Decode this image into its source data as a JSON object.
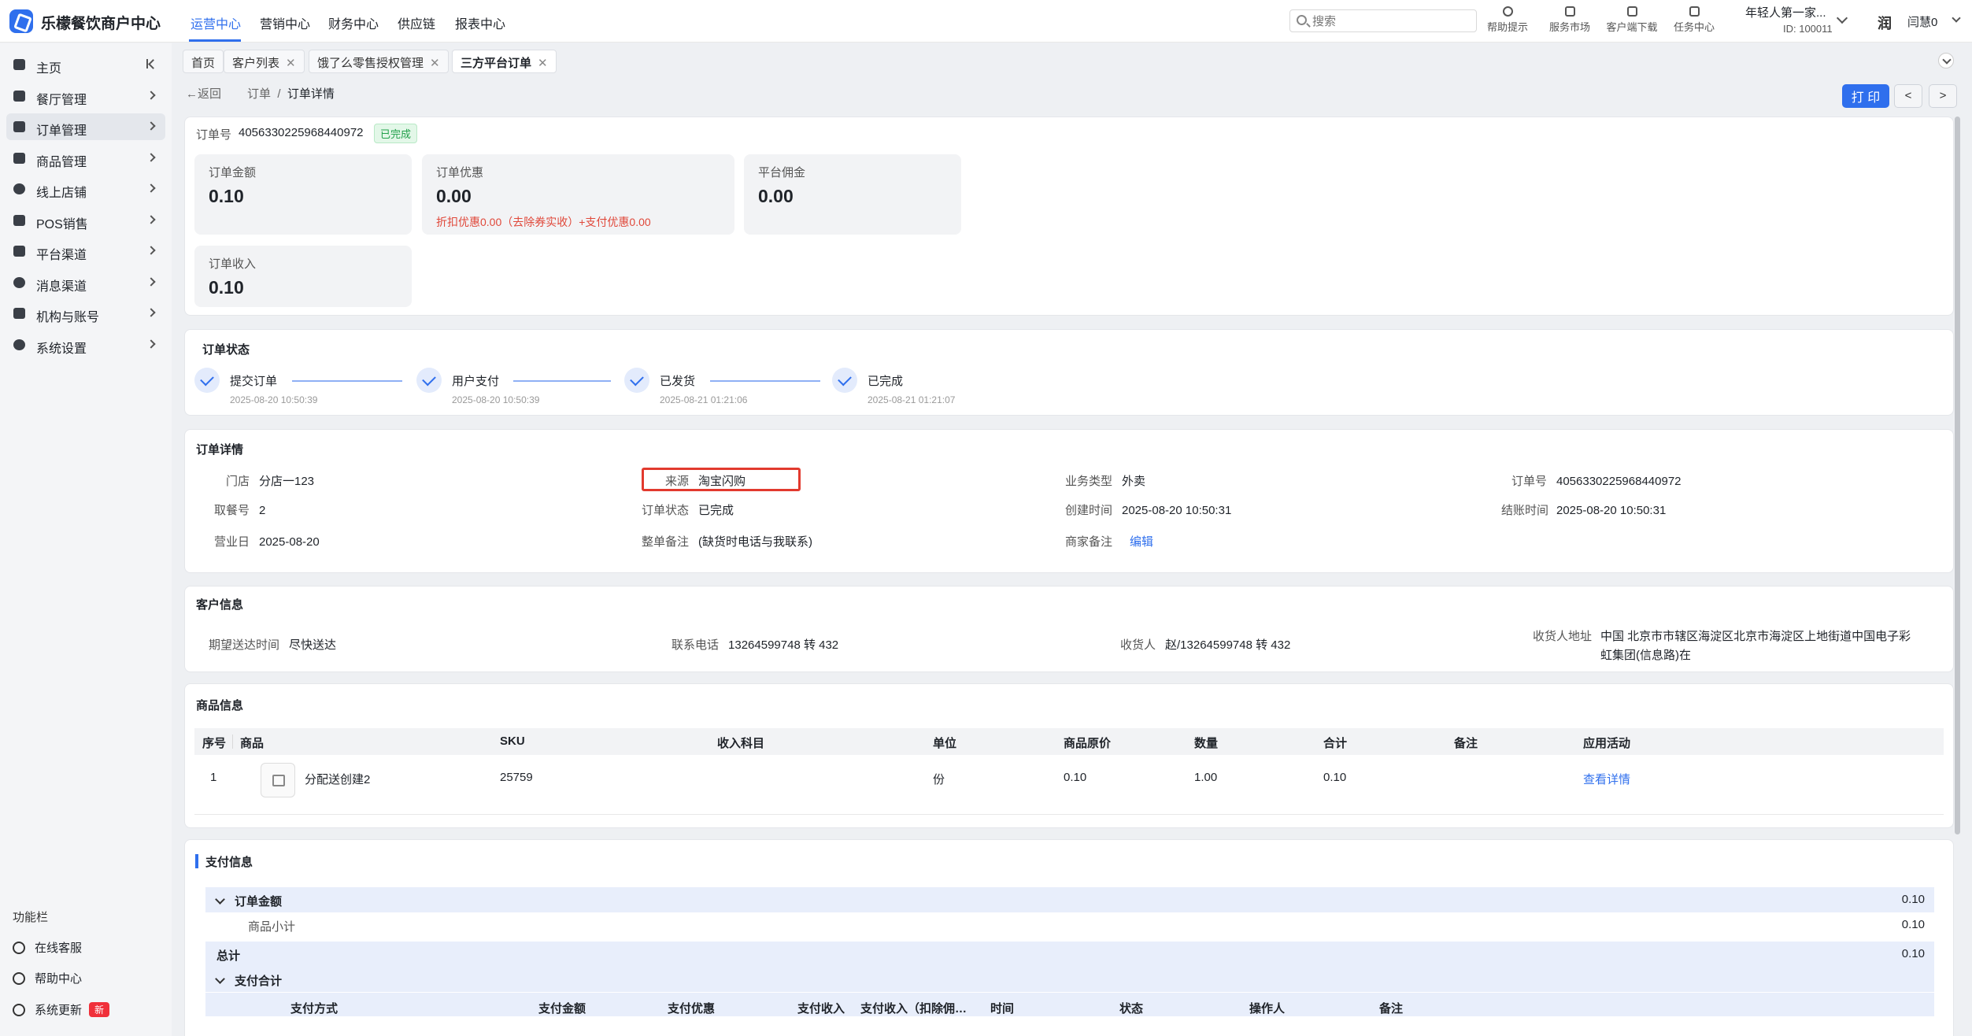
{
  "app": {
    "brand": "乐檬餐饮商户中心",
    "nav": [
      "运营中心",
      "营销中心",
      "财务中心",
      "供应链",
      "报表中心"
    ],
    "search_placeholder": "搜索",
    "tools": [
      "帮助提示",
      "服务市场",
      "客户端下载",
      "任务中心"
    ],
    "account_name": "年轻人第一家...",
    "account_id": "ID: 100011",
    "avatar_text": "润",
    "username": "闫慧0"
  },
  "sidebar": {
    "items": [
      {
        "label": "主页",
        "icon": "home-icon"
      },
      {
        "label": "餐厅管理",
        "icon": "store-icon"
      },
      {
        "label": "订单管理",
        "icon": "order-icon"
      },
      {
        "label": "商品管理",
        "icon": "goods-icon"
      },
      {
        "label": "线上店铺",
        "icon": "globe-icon"
      },
      {
        "label": "POS销售",
        "icon": "cart-icon"
      },
      {
        "label": "平台渠道",
        "icon": "bank-icon"
      },
      {
        "label": "消息渠道",
        "icon": "message-icon"
      },
      {
        "label": "机构与账号",
        "icon": "org-icon"
      },
      {
        "label": "系统设置",
        "icon": "gear-icon"
      }
    ],
    "func_title": "功能栏",
    "func_items": [
      {
        "label": "在线客服",
        "icon": "support-icon"
      },
      {
        "label": "帮助中心",
        "icon": "help-icon"
      },
      {
        "label": "系统更新",
        "icon": "refresh-icon"
      }
    ],
    "new_badge": "新"
  },
  "tabs": [
    "首页",
    "客户列表",
    "饿了么零售授权管理",
    "三方平台订单"
  ],
  "header": {
    "back": "返回",
    "crumb_parent": "订单",
    "crumb_sep": "/",
    "crumb_current": "订单详情",
    "print": "打 印",
    "prev": "<",
    "next": ">"
  },
  "order": {
    "no_label": "订单号",
    "no": "4056330225968440972",
    "status_badge": "已完成",
    "stats": [
      {
        "label": "订单金额",
        "value": "0.10",
        "note": ""
      },
      {
        "label": "订单优惠",
        "value": "0.00",
        "note": "折扣优惠0.00（去除券实收）+支付优惠0.00"
      },
      {
        "label": "平台佣金",
        "value": "0.00",
        "note": ""
      },
      {
        "label": "订单收入",
        "value": "0.10",
        "note": ""
      }
    ]
  },
  "status_section": {
    "title": "订单状态",
    "steps": [
      {
        "name": "提交订单",
        "time": "2025-08-20 10:50:39"
      },
      {
        "name": "用户支付",
        "time": "2025-08-20 10:50:39"
      },
      {
        "name": "已发货",
        "time": "2025-08-21 01:21:06"
      },
      {
        "name": "已完成",
        "time": "2025-08-21 01:21:07"
      }
    ]
  },
  "detail_section": {
    "title": "订单详情",
    "fields": {
      "store": {
        "k": "门店",
        "v": "分店一123"
      },
      "source": {
        "k": "来源",
        "v": "淘宝闪购"
      },
      "biz_type": {
        "k": "业务类型",
        "v": "外卖"
      },
      "order_no": {
        "k": "订单号",
        "v": "4056330225968440972"
      },
      "pickup": {
        "k": "取餐号",
        "v": "2"
      },
      "status": {
        "k": "订单状态",
        "v": "已完成"
      },
      "created": {
        "k": "创建时间",
        "v": "2025-08-20 10:50:31"
      },
      "settled": {
        "k": "结账时间",
        "v": "2025-08-20 10:50:31"
      },
      "biz_day": {
        "k": "营业日",
        "v": "2025-08-20"
      },
      "remark": {
        "k": "整单备注",
        "v": "(缺货时电话与我联系)"
      },
      "merchant_note": {
        "k": "商家备注",
        "v": "编辑"
      }
    }
  },
  "customer_section": {
    "title": "客户信息",
    "expected_k": "期望送达时间",
    "expected_v": "尽快送达",
    "phone_k": "联系电话",
    "phone_v": "13264599748 转 432",
    "receiver_k": "收货人",
    "receiver_v": "赵/13264599748 转 432",
    "address_k": "收货人地址",
    "address_line1": "中国 北京市市辖区海淀区北京市海淀区上地街道中国电子彩",
    "address_line2": "虹集团(信息路)在"
  },
  "goods_section": {
    "title": "商品信息",
    "columns": [
      "序号",
      "商品",
      "SKU",
      "收入科目",
      "单位",
      "商品原价",
      "数量",
      "合计",
      "备注",
      "应用活动"
    ],
    "rows": [
      {
        "idx": "1",
        "name": "分配送创建2",
        "sku": "25759",
        "subject": "",
        "unit": "份",
        "price": "0.10",
        "qty": "1.00",
        "total": "0.10",
        "note": "",
        "action": "查看详情"
      }
    ]
  },
  "payment_section": {
    "title": "支付信息",
    "order_amount_label": "订单金额",
    "order_amount": "0.10",
    "subtotal_label": "商品小计",
    "subtotal": "0.10",
    "total_label": "总计",
    "total": "0.10",
    "pay_total_label": "支付合计",
    "columns": [
      "支付方式",
      "支付金额",
      "支付优惠",
      "支付收入",
      "支付收入（扣除佣…",
      "时间",
      "状态",
      "操作人",
      "备注"
    ]
  }
}
